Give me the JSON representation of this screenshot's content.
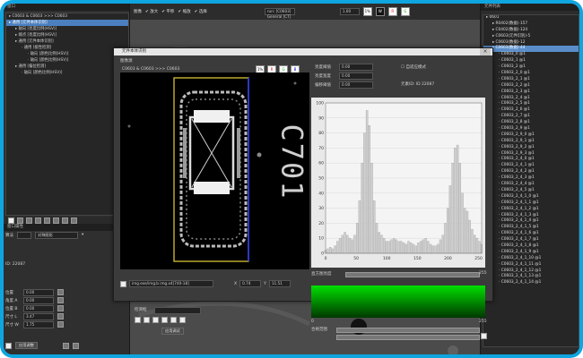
{
  "left": {
    "title": "窗口",
    "tree": [
      {
        "text": "C0603 & C0603 >>> C0603",
        "indent": 0,
        "sel": false
      },
      {
        "text": "通用 [元件本体识别]",
        "indent": 0,
        "sel": true
      },
      {
        "text": "轴向 [亮度比例(HSV)]",
        "indent": 1,
        "sel": false
      },
      {
        "text": "端点 [亮度比例(HSV)]",
        "indent": 1,
        "sel": false
      },
      {
        "text": "通用 [元件本体识别]",
        "indent": 1,
        "sel": false
      },
      {
        "text": "通用 [极性检测]",
        "indent": 2,
        "sel": false
      },
      {
        "text": "轴向 [颜色比例(HSV)]",
        "indent": 3,
        "sel": false
      },
      {
        "text": "轴向 [颜色比例(HSV)]",
        "indent": 3,
        "sel": false
      },
      {
        "text": "通用 [偏位检测]",
        "indent": 1,
        "sel": false
      },
      {
        "text": "轴向 [颜色比例(HSV)]",
        "indent": 2,
        "sel": false
      }
    ],
    "props_title": "窗口属性",
    "algo_label": "算法",
    "algo_value": "对称图形",
    "id_label": "ID: 22087",
    "fields": [
      {
        "label": "位置",
        "value": "0.00"
      },
      {
        "label": "角度 A",
        "value": "0.00"
      },
      {
        "label": "位置 B",
        "value": "0.00"
      },
      {
        "label": "尺寸 L",
        "value": "3.47"
      },
      {
        "label": "尺寸 W",
        "value": "1.75"
      }
    ],
    "bottom_btn": "应用调整"
  },
  "toolbar": {
    "title": "图像",
    "items": [
      "放大",
      "平移",
      "缩放",
      "选择"
    ],
    "run_label": "run: [C0603] General [CT]",
    "zoom": "1.00",
    "chips": [
      "1%",
      "W",
      "R",
      "G"
    ]
  },
  "dialog": {
    "title": "元件本体识别",
    "image_title": "图像源",
    "image_caption": "C0603 & C0603 >>> C0603",
    "chips": [
      "1%",
      "R",
      "G",
      "B"
    ],
    "status_path": "img.exe/img.b img.x4[740-18]",
    "status_x_label": "X",
    "status_x": "0.74",
    "status_y_label": "Y",
    "status_y": "11.51",
    "controls": [
      {
        "label": "亮度阈值",
        "value": "0.00"
      },
      {
        "label": "亮度宽度",
        "value": "0.00"
      },
      {
        "label": "偏移阈值",
        "value": "0.00"
      }
    ],
    "check_label": "自适应模式",
    "id_label": "元素ID: ID 22087",
    "hist_label": "直方图亮度",
    "hist_slider_value": "255",
    "range_label": "合格范围",
    "range_from": "0",
    "range_to": "255",
    "apply_label": "应用",
    "mark_label": "C701"
  },
  "chart_data": {
    "type": "area",
    "x": [
      0,
      4,
      8,
      12,
      16,
      20,
      24,
      28,
      32,
      36,
      40,
      44,
      48,
      52,
      56,
      60,
      64,
      68,
      72,
      76,
      80,
      84,
      88,
      92,
      96,
      100,
      104,
      108,
      112,
      116,
      120,
      124,
      128,
      132,
      136,
      140,
      144,
      148,
      152,
      156,
      160,
      164,
      168,
      172,
      176,
      180,
      184,
      188,
      192,
      196,
      200,
      204,
      208,
      212,
      216,
      220,
      224,
      228,
      232,
      236,
      240,
      244,
      248,
      252,
      255
    ],
    "values": [
      2,
      3,
      4,
      3,
      5,
      8,
      10,
      12,
      14,
      12,
      10,
      9,
      12,
      20,
      35,
      60,
      80,
      95,
      85,
      60,
      35,
      20,
      14,
      12,
      10,
      8,
      8,
      9,
      10,
      9,
      8,
      8,
      7,
      6,
      8,
      7,
      6,
      5,
      7,
      8,
      9,
      10,
      8,
      6,
      5,
      5,
      6,
      9,
      12,
      20,
      30,
      45,
      60,
      70,
      72,
      60,
      40,
      30,
      28,
      22,
      16,
      12,
      10,
      8,
      6
    ],
    "xlim": [
      0,
      255
    ],
    "ylim": [
      0,
      100
    ],
    "xticks": [
      0,
      50,
      100,
      150,
      200,
      250
    ],
    "yticks": [
      0,
      10,
      20,
      30,
      40,
      50,
      60,
      70,
      80,
      90,
      100
    ]
  },
  "right": {
    "title": "元件列表",
    "tree": [
      {
        "text": "0601",
        "indent": 0,
        "sel": false
      },
      {
        "text": "R0402(数据)-157",
        "indent": 1,
        "sel": false
      },
      {
        "text": "C0402(数据)-124",
        "indent": 1,
        "sel": false
      },
      {
        "text": "C0603(元件识别)-5",
        "indent": 1,
        "sel": false
      },
      {
        "text": "C0603(数据)-12",
        "indent": 1,
        "sel": false
      },
      {
        "text": "C0603(数据)-44",
        "indent": 1,
        "sel": true
      },
      {
        "text": "C0603_0 @1",
        "indent": 2,
        "sel": false
      },
      {
        "text": "C0603_1 @1",
        "indent": 2,
        "sel": false
      },
      {
        "text": "C0603_2 @1",
        "indent": 2,
        "sel": false
      },
      {
        "text": "C0603_2_0 @1",
        "indent": 2,
        "sel": false
      },
      {
        "text": "C0603_2_1 @1",
        "indent": 2,
        "sel": false
      },
      {
        "text": "C0603_2_2 @1",
        "indent": 2,
        "sel": false
      },
      {
        "text": "C0603_2_3 @1",
        "indent": 2,
        "sel": false
      },
      {
        "text": "C0603_2_4 @1",
        "indent": 2,
        "sel": false
      },
      {
        "text": "C0603_2_5 @1",
        "indent": 2,
        "sel": false
      },
      {
        "text": "C0603_2_6 @1",
        "indent": 2,
        "sel": false
      },
      {
        "text": "C0603_2_7 @1",
        "indent": 2,
        "sel": false
      },
      {
        "text": "C0603_2_8 @1",
        "indent": 2,
        "sel": false
      },
      {
        "text": "C0603_2_9 @1",
        "indent": 2,
        "sel": false
      },
      {
        "text": "C0603_2_9_0 @1",
        "indent": 2,
        "sel": false
      },
      {
        "text": "C0603_2_9_1 @1",
        "indent": 2,
        "sel": false
      },
      {
        "text": "C0603_2_9_2 @1",
        "indent": 2,
        "sel": false
      },
      {
        "text": "C0603_2_9_3 @1",
        "indent": 2,
        "sel": false
      },
      {
        "text": "C0603_2_4_0 @1",
        "indent": 2,
        "sel": false
      },
      {
        "text": "C0603_2_4_1 @1",
        "indent": 2,
        "sel": false
      },
      {
        "text": "C0603_2_4_2 @1",
        "indent": 2,
        "sel": false
      },
      {
        "text": "C0603_2_4_3 @1",
        "indent": 2,
        "sel": false
      },
      {
        "text": "C0603_2_4_4 @1",
        "indent": 2,
        "sel": false
      },
      {
        "text": "C0603_2_4_5 @1",
        "indent": 2,
        "sel": false
      },
      {
        "text": "C0603_2_4_1_0 @1",
        "indent": 2,
        "sel": false
      },
      {
        "text": "C0603_2_4_1_1 @1",
        "indent": 2,
        "sel": false
      },
      {
        "text": "C0603_2_4_1_2 @1",
        "indent": 2,
        "sel": false
      },
      {
        "text": "C0603_2_4_1_3 @1",
        "indent": 2,
        "sel": false
      },
      {
        "text": "C0603_2_4_1_4 @1",
        "indent": 2,
        "sel": false
      },
      {
        "text": "C0603_2_4_1_5 @1",
        "indent": 2,
        "sel": false
      },
      {
        "text": "C0603_2_4_1_6 @1",
        "indent": 2,
        "sel": false
      },
      {
        "text": "C0603_2_4_1_7 @1",
        "indent": 2,
        "sel": false
      },
      {
        "text": "C0603_2_4_1_8 @1",
        "indent": 2,
        "sel": false
      },
      {
        "text": "C0603_2_4_1_9 @1",
        "indent": 2,
        "sel": false
      },
      {
        "text": "C0603_2_4_1_10 @1",
        "indent": 2,
        "sel": false
      },
      {
        "text": "C0603_2_4_1_11 @1",
        "indent": 2,
        "sel": false
      },
      {
        "text": "C0603_2_4_1_12 @1",
        "indent": 2,
        "sel": false
      },
      {
        "text": "C0603_2_4_1_13 @1",
        "indent": 2,
        "sel": false
      },
      {
        "text": "C0603_2_4_1_14 @1",
        "indent": 2,
        "sel": false
      }
    ]
  },
  "canvas_bottom": {
    "label": "检测框",
    "button": "应用调试"
  },
  "colors": {
    "frame": "#0fa6e0",
    "selection": "#4b7fbf",
    "roi_yellow": "#e8d23a",
    "roi_blue": "#2a3dff",
    "green": "#00e000"
  }
}
